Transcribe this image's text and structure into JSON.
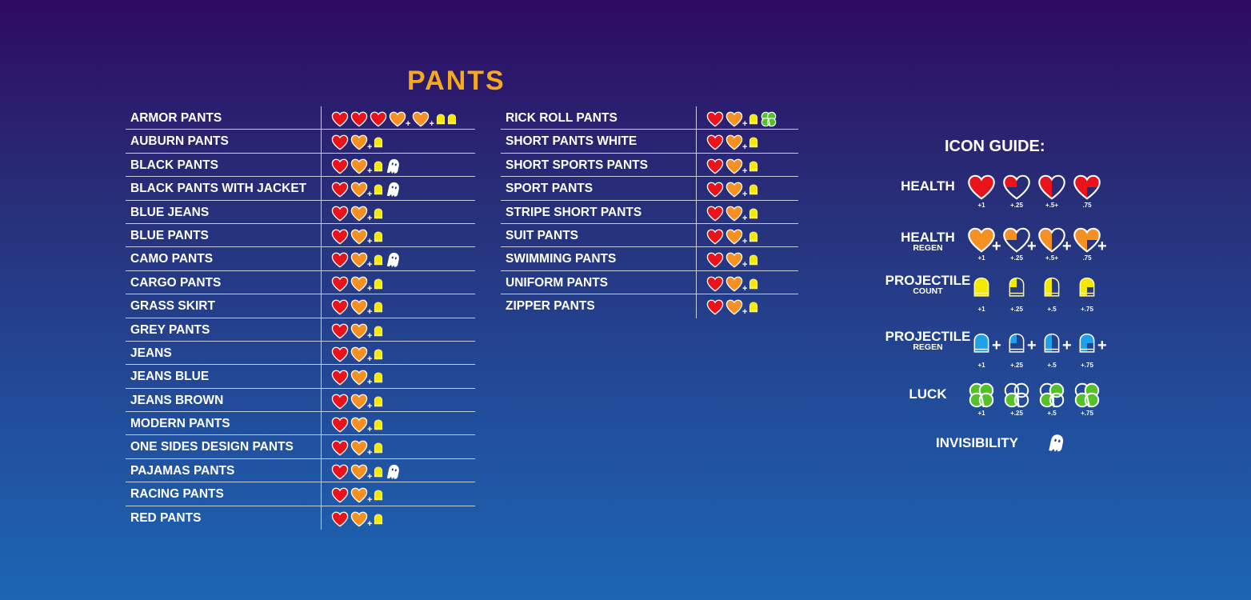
{
  "title": "PANTS",
  "colors": {
    "health": "#e8131b",
    "health_regen": "#f59122",
    "projectile": "#f4ea00",
    "projectile_regen": "#1ea1e8",
    "luck": "#54c02a",
    "background_top": "#2e0b62",
    "background_bottom": "#1c66b4",
    "title": "#f7a91d"
  },
  "left_table": [
    {
      "name": "ARMOR PANTS",
      "icons": [
        "heart",
        "heart",
        "heart",
        "heart-regen",
        "heart-regen",
        "bullet",
        "bullet"
      ]
    },
    {
      "name": "AUBURN PANTS",
      "icons": [
        "heart",
        "heart-regen",
        "bullet"
      ]
    },
    {
      "name": "BLACK PANTS",
      "icons": [
        "heart",
        "heart-regen",
        "bullet",
        "ghost"
      ]
    },
    {
      "name": "BLACK PANTS WITH JACKET",
      "icons": [
        "heart",
        "heart-regen",
        "bullet",
        "ghost"
      ]
    },
    {
      "name": "BLUE JEANS",
      "icons": [
        "heart",
        "heart-regen",
        "bullet"
      ]
    },
    {
      "name": "BLUE PANTS",
      "icons": [
        "heart",
        "heart-regen",
        "bullet"
      ]
    },
    {
      "name": "CAMO PANTS",
      "icons": [
        "heart",
        "heart-regen",
        "bullet",
        "ghost"
      ]
    },
    {
      "name": "CARGO PANTS",
      "icons": [
        "heart",
        "heart-regen",
        "bullet"
      ]
    },
    {
      "name": "GRASS SKIRT",
      "icons": [
        "heart",
        "heart-regen",
        "bullet"
      ]
    },
    {
      "name": "GREY PANTS",
      "icons": [
        "heart",
        "heart-regen",
        "bullet"
      ]
    },
    {
      "name": "JEANS",
      "icons": [
        "heart",
        "heart-regen",
        "bullet"
      ]
    },
    {
      "name": "JEANS BLUE",
      "icons": [
        "heart",
        "heart-regen",
        "bullet"
      ]
    },
    {
      "name": "JEANS BROWN",
      "icons": [
        "heart",
        "heart-regen",
        "bullet"
      ]
    },
    {
      "name": "MODERN PANTS",
      "icons": [
        "heart",
        "heart-regen",
        "bullet"
      ]
    },
    {
      "name": "ONE SIDES DESIGN PANTS",
      "icons": [
        "heart",
        "heart-regen",
        "bullet"
      ]
    },
    {
      "name": "PAJAMAS PANTS",
      "icons": [
        "heart",
        "heart-regen",
        "bullet",
        "ghost"
      ]
    },
    {
      "name": "RACING PANTS",
      "icons": [
        "heart",
        "heart-regen",
        "bullet"
      ]
    },
    {
      "name": "RED PANTS",
      "icons": [
        "heart",
        "heart-regen",
        "bullet"
      ]
    }
  ],
  "right_table": [
    {
      "name": "RICK ROLL PANTS",
      "icons": [
        "heart",
        "heart-regen",
        "bullet",
        "clover"
      ]
    },
    {
      "name": "SHORT PANTS WHITE",
      "icons": [
        "heart",
        "heart-regen",
        "bullet"
      ]
    },
    {
      "name": "SHORT SPORTS PANTS",
      "icons": [
        "heart",
        "heart-regen",
        "bullet"
      ]
    },
    {
      "name": "SPORT PANTS",
      "icons": [
        "heart",
        "heart-regen",
        "bullet"
      ]
    },
    {
      "name": "STRIPE SHORT PANTS",
      "icons": [
        "heart",
        "heart-regen",
        "bullet"
      ]
    },
    {
      "name": "SUIT PANTS",
      "icons": [
        "heart",
        "heart-regen",
        "bullet"
      ]
    },
    {
      "name": "SWIMMING PANTS",
      "icons": [
        "heart",
        "heart-regen",
        "bullet"
      ]
    },
    {
      "name": "UNIFORM PANTS",
      "icons": [
        "heart",
        "heart-regen",
        "bullet"
      ]
    },
    {
      "name": "ZIPPER PANTS",
      "icons": [
        "heart",
        "heart-regen",
        "bullet"
      ]
    }
  ],
  "guide": {
    "title": "ICON GUIDE:",
    "rows": [
      {
        "label": "HEALTH",
        "sub": "",
        "type": "heart",
        "items": [
          "+1",
          "+.25",
          "+.5+",
          ".75"
        ],
        "plus": false
      },
      {
        "label": "HEALTH",
        "sub": "REGEN",
        "type": "heart-regen",
        "items": [
          "+1",
          "+.25",
          "+.5+",
          ".75"
        ],
        "plus": true
      },
      {
        "label": "PROJECTILE",
        "sub": "COUNT",
        "type": "bullet",
        "items": [
          "+1",
          "+.25",
          "+.5",
          "+.75"
        ],
        "plus": false
      },
      {
        "label": "PROJECTILE",
        "sub": "REGEN",
        "type": "bullet-regen",
        "items": [
          "+1",
          "+.25",
          "+.5",
          "+.75"
        ],
        "plus": true
      },
      {
        "label": "LUCK",
        "sub": "",
        "type": "clover",
        "items": [
          "+1",
          "+.25",
          "+.5",
          "+.75"
        ],
        "plus": false
      }
    ],
    "invisibility_label": "INVISIBILITY"
  }
}
